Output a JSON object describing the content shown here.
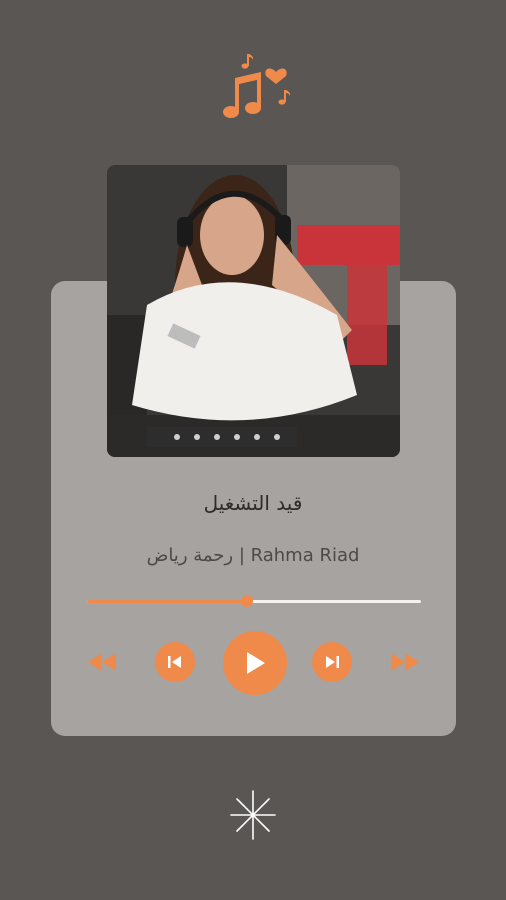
{
  "player": {
    "status": "قيد التشغيل",
    "track": "رحمة رياض | Rahma Riad",
    "progress": 0.48
  },
  "icons": {
    "logo": "music-notes-heart-icon",
    "rewind": "rewind-icon",
    "previous": "skip-previous-icon",
    "play": "play-icon",
    "next": "skip-next-icon",
    "forward": "fast-forward-icon",
    "sparkle": "sparkle-icon"
  },
  "colors": {
    "background": "#5a5654",
    "card": "#a6a3a0",
    "accent": "#f08a4b",
    "track": "#f5f2ee"
  }
}
